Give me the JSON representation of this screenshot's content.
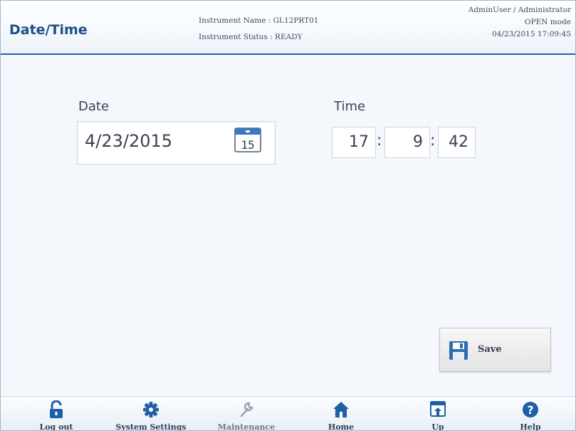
{
  "header": {
    "title": "Date/Time",
    "instrument_name": "Instrument Name : GL12PRT01",
    "instrument_status": "Instrument Status : READY",
    "user": "AdminUser / Administrator",
    "mode": "OPEN mode",
    "datetime": "04/23/2015 17:09:45"
  },
  "form": {
    "date_label": "Date",
    "date_value": "4/23/2015",
    "calendar_day": "15",
    "time_label": "Time",
    "hour": "17",
    "minute": "9",
    "second": "42",
    "separator": ":"
  },
  "actions": {
    "save_label": "Save"
  },
  "footer": {
    "items": [
      {
        "label": "Log out",
        "icon": "unlock-icon"
      },
      {
        "label": "System Settings",
        "icon": "gear-icon"
      },
      {
        "label": "Maintenance",
        "icon": "wrench-icon",
        "disabled": true
      },
      {
        "label": "Home",
        "icon": "home-icon"
      },
      {
        "label": "Up",
        "icon": "up-icon"
      },
      {
        "label": "Help",
        "icon": "help-icon"
      }
    ]
  },
  "colors": {
    "accent": "#1e5fa8",
    "icon_blue": "#1f5fa6",
    "title": "#1e4f87"
  }
}
